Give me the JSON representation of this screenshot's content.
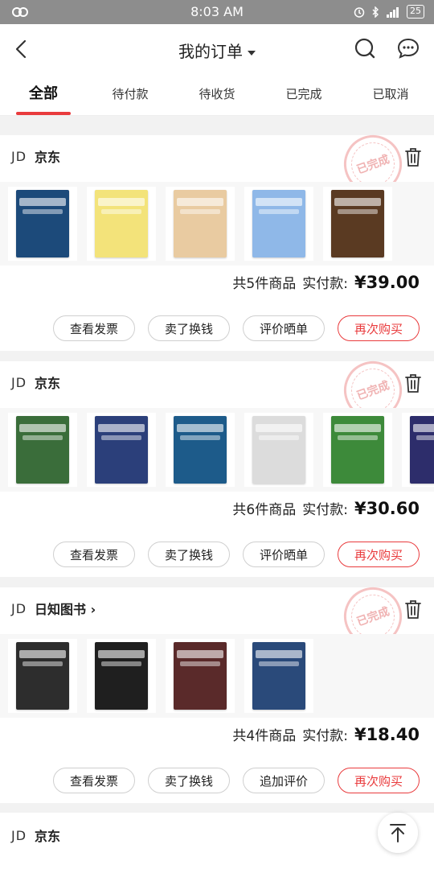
{
  "statusbar": {
    "time": "8:03 AM",
    "battery": "25"
  },
  "nav": {
    "title": "我的订单"
  },
  "tabs": [
    "全部",
    "待付款",
    "待收货",
    "已完成",
    "已取消"
  ],
  "stamp_text": "已完成",
  "orders": [
    {
      "shop_prefix": "JD",
      "shop_name": "京东",
      "count_text": "共5件商品",
      "paid_label": "实付款:",
      "price": "¥39.00",
      "buttons": [
        "查看发票",
        "卖了换钱",
        "评价晒单",
        "再次购买"
      ],
      "book_colors": [
        "#1c4a7a",
        "#f3e37a",
        "#e9cba1",
        "#8fb8e8",
        "#5a3a22"
      ]
    },
    {
      "shop_prefix": "JD",
      "shop_name": "京东",
      "count_text": "共6件商品",
      "paid_label": "实付款:",
      "price": "¥30.60",
      "buttons": [
        "查看发票",
        "卖了换钱",
        "评价晒单",
        "再次购买"
      ],
      "book_colors": [
        "#3a6d3a",
        "#2b3f7a",
        "#1d5b8a",
        "#dcdcdc",
        "#3d8a3a",
        "#2d2d6b"
      ]
    },
    {
      "shop_prefix": "JD",
      "shop_name": "日知图书 ›",
      "count_text": "共4件商品",
      "paid_label": "实付款:",
      "price": "¥18.40",
      "buttons": [
        "查看发票",
        "卖了换钱",
        "追加评价",
        "再次购买"
      ],
      "book_colors": [
        "#2d2d2d",
        "#1f1f1f",
        "#5a2a2a",
        "#2a4a7a"
      ]
    }
  ],
  "partial_order": {
    "shop_prefix": "JD",
    "shop_name": "京东"
  }
}
